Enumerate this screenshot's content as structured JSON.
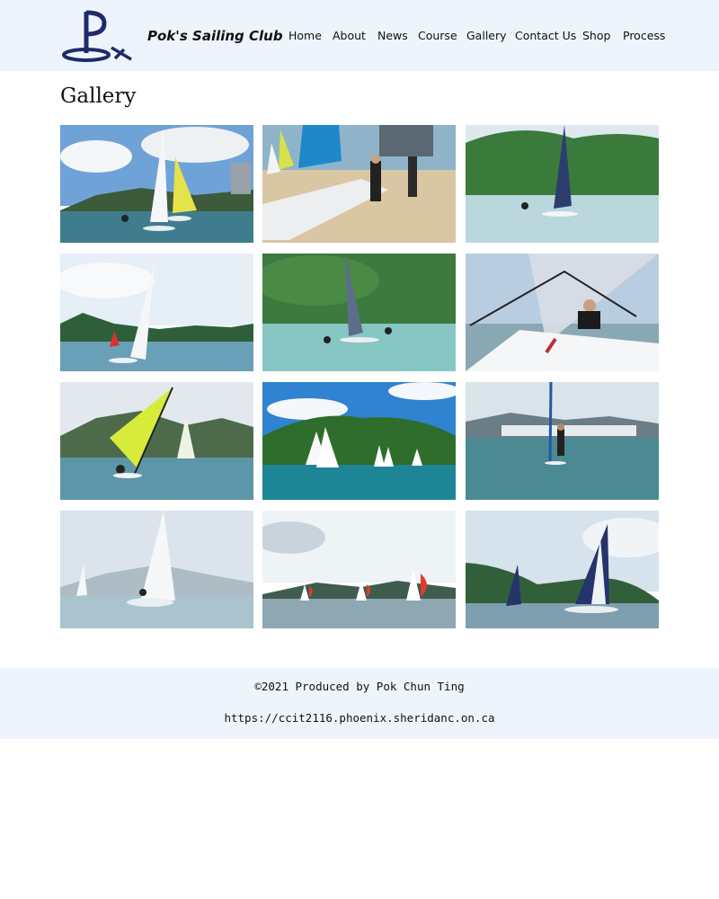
{
  "header": {
    "brand": "Pok's Sailing Club",
    "nav": [
      "Home",
      "About",
      "News",
      "Course",
      "Gallery",
      "Contact Us",
      "Shop",
      "Process"
    ]
  },
  "main": {
    "title": "Gallery",
    "photos": [
      {
        "scene": "two dinghies under cloudy sky, coastal town"
      },
      {
        "scene": "catamarans on beach with sailors"
      },
      {
        "scene": "catamaran in front of green hill"
      },
      {
        "scene": "dinghy sailing near mountains"
      },
      {
        "scene": "catamaran with crew on trapeze, green hill"
      },
      {
        "scene": "sailor on catamaran hull close-up"
      },
      {
        "scene": "dinghy with yellow sail and mountains"
      },
      {
        "scene": "white sails near green island"
      },
      {
        "scene": "windsurfer near distant shore"
      },
      {
        "scene": "dinghy with numbered sail in haze"
      },
      {
        "scene": "small boats with red spinnakers"
      },
      {
        "scene": "catamarans with dark sails near hills"
      }
    ]
  },
  "footer": {
    "credit": "©2021 Produced by Pok Chun Ting",
    "url": "https://ccit2116.phoenix.sheridanc.on.ca"
  },
  "colors": {
    "header_bg": "#eef4fb",
    "footer_bg": "#eef4fb",
    "logo_navy": "#1f2a6b"
  }
}
